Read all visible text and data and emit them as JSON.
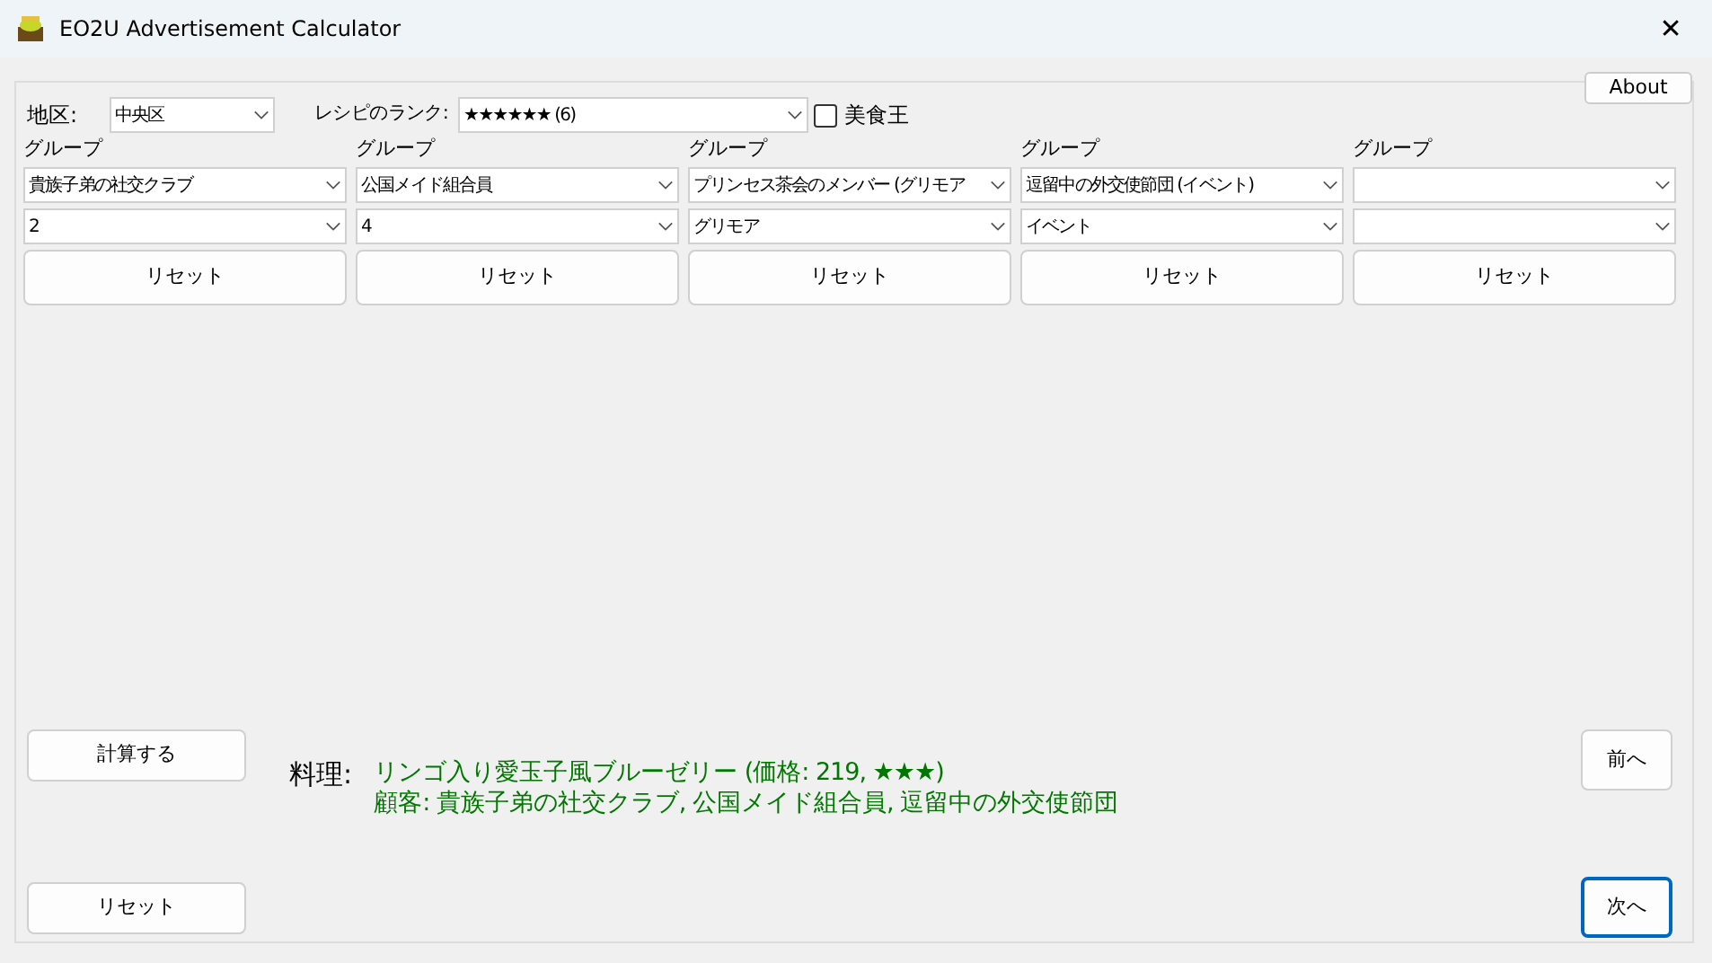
{
  "window": {
    "title": "EO2U Advertisement Calculator",
    "close": "✕"
  },
  "about_button": "About",
  "district": {
    "label": "地区:",
    "value": "中央区"
  },
  "recipe_rank": {
    "label": "レシピのランク:",
    "value": "★★★★★★ (6)"
  },
  "gourmet_king": {
    "label": "美食王",
    "checked": false
  },
  "groups": [
    {
      "label": "グループ",
      "group": "貴族子弟の社交クラブ",
      "sub": "2",
      "reset": "リセット"
    },
    {
      "label": "グループ",
      "group": "公国メイド組合員",
      "sub": "4",
      "reset": "リセット"
    },
    {
      "label": "グループ",
      "group": "プリンセス茶会のメンバー (グリモア",
      "sub": "グリモア",
      "reset": "リセット"
    },
    {
      "label": "グループ",
      "group": "逗留中の外交使節団 (イベント)",
      "sub": "イベント",
      "reset": "リセット"
    },
    {
      "label": "グループ",
      "reset": "リセット"
    }
  ],
  "calculate_button": "計算する",
  "reset_all_button": "リセット",
  "result": {
    "label": "料理:",
    "dish": "リンゴ入り愛玉子風ブルーゼリー (価格: 219, ★★★)",
    "customers": "顧客: 貴族子弟の社交クラブ, 公国メイド組合員, 逗留中の外交使節団"
  },
  "nav_buttons": [
    {
      "label": "前へ",
      "focused": false
    },
    {
      "label": "次へ",
      "focused": true
    }
  ]
}
